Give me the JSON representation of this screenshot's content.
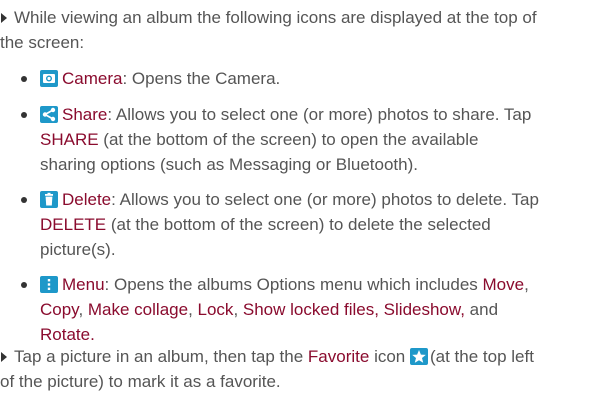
{
  "colors": {
    "text": "#555555",
    "keyword": "#8a0b2e",
    "icon_bg": "#1e98c9",
    "star": "#ffffff"
  },
  "intro": {
    "line1": "While viewing an album the following icons are displayed at the top of",
    "line2": "the screen:"
  },
  "items": [
    {
      "icon": "camera-icon",
      "term": "Camera",
      "desc": ": Opens the Camera."
    },
    {
      "icon": "share-icon",
      "term": "Share",
      "desc1": ": Allows you to select one (or more) photos to share. Tap",
      "kw": "SHARE",
      "desc2": " (at the bottom of the screen) to open the available",
      "desc3": "sharing options (such as Messaging or Bluetooth)."
    },
    {
      "icon": "trash-icon",
      "term": "Delete",
      "desc1": ": Allows you to select one (or more) photos to delete. Tap",
      "kw": "DELETE",
      "desc2": " (at the bottom of the screen) to delete the selected",
      "desc3": "picture(s)."
    },
    {
      "icon": "menu-icon",
      "term": "Menu",
      "desc1": ": Opens the albums Options menu which includes ",
      "move": "Move",
      "comma1": ",",
      "copy": "Copy",
      "comma2": ", ",
      "collage": "Make collage",
      "comma3": ", ",
      "lock": "Lock",
      "comma4": ", ",
      "locked": "Show locked files, Slideshow,",
      "and": " and",
      "rotate": "Rotate."
    }
  ],
  "outro": {
    "pre": "Tap a picture in an album, then tap the ",
    "term": "Favorite",
    "mid": " icon ",
    "post": "(at the top left",
    "line2": "of the picture) to mark it as a favorite.",
    "icon": "star-icon"
  }
}
